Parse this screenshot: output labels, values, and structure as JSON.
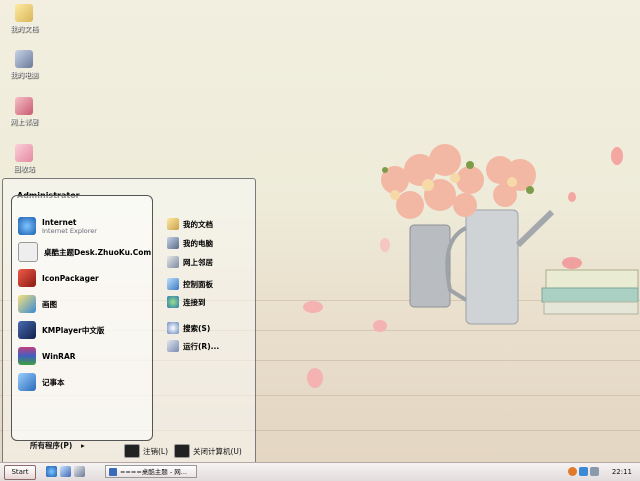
{
  "desktop_icons": [
    {
      "label": "我的文档",
      "icon": "my-documents-icon"
    },
    {
      "label": "我的电脑",
      "icon": "my-computer-icon"
    },
    {
      "label": "网上邻居",
      "icon": "network-places-icon"
    },
    {
      "label": "回收站",
      "icon": "recycle-bin-icon"
    }
  ],
  "start_menu": {
    "user": "Administrator",
    "pinned": [
      {
        "title": "Internet",
        "subtitle": "Internet Explorer",
        "icon": "internet-explorer-icon"
      },
      {
        "title": "桌酷主题Desk.ZhuoKu.Com",
        "icon": "zhuoku-theme-icon"
      }
    ],
    "recent": [
      {
        "title": "IconPackager",
        "icon": "iconpackager-icon"
      },
      {
        "title": "画图",
        "icon": "paint-icon"
      },
      {
        "title": "KMPlayer中文版",
        "icon": "kmplayer-icon"
      },
      {
        "title": "WinRAR",
        "icon": "winrar-icon"
      },
      {
        "title": "记事本",
        "icon": "notepad-icon"
      }
    ],
    "all_programs": "所有程序(P)",
    "right_items": [
      {
        "label": "我的文档",
        "icon": "my-documents-icon"
      },
      {
        "label": "我的电脑",
        "icon": "my-computer-icon"
      },
      {
        "label": "网上邻居",
        "icon": "network-places-icon"
      },
      {
        "label": "控制面板",
        "icon": "control-panel-icon"
      },
      {
        "label": "连接到",
        "icon": "connect-to-icon"
      },
      {
        "label": "搜索(S)",
        "icon": "search-icon"
      },
      {
        "label": "运行(R)...",
        "icon": "run-icon"
      }
    ],
    "logoff": "注销(L)",
    "shutdown": "关闭计算机(U)"
  },
  "taskbar": {
    "start_label": "Start",
    "task_item": "====桌酷主题 - 网...",
    "clock": "22:11"
  },
  "colors": {
    "desktop_bg": "#efecdc",
    "taskbar_bg": "#efe9e9"
  }
}
